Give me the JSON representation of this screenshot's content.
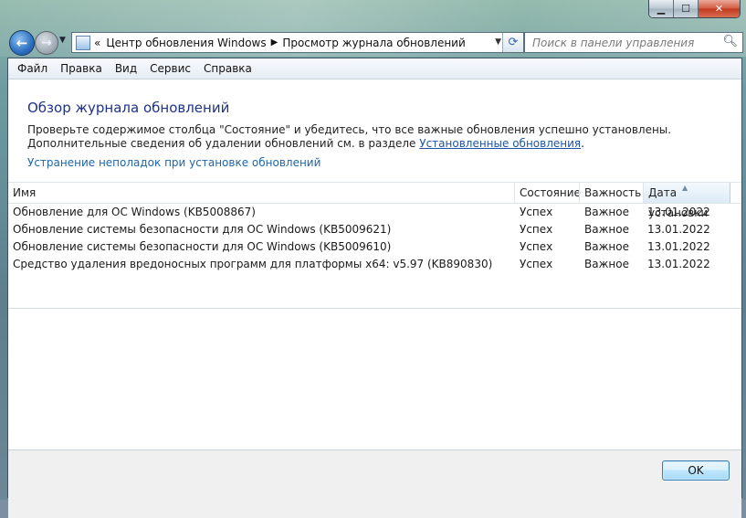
{
  "window": {
    "caption_buttons": {
      "minimize": "▁",
      "maximize": "☐",
      "close": "✕"
    }
  },
  "nav": {
    "back_icon": "arrow-left-icon",
    "forward_icon": "arrow-right-icon",
    "address": {
      "prefix": "«",
      "crumbs": [
        "Центр обновления Windows",
        "Просмотр журнала обновлений"
      ],
      "separator": "▶"
    },
    "search_placeholder": "Поиск в панели управления"
  },
  "menu": [
    "Файл",
    "Правка",
    "Вид",
    "Сервис",
    "Справка"
  ],
  "main": {
    "title": "Обзор журнала обновлений",
    "description_part1": "Проверьте содержимое столбца \"Состояние\" и убедитесь, что все важные обновления успешно установлены. Дополнительные сведения об удалении обновлений см. в разделе ",
    "description_link": "Установленные обновления",
    "description_end": ".",
    "troubleshoot_link": "Устранение неполадок при установке обновлений"
  },
  "table": {
    "columns": [
      "Имя",
      "Состояние",
      "Важность",
      "Дата установки"
    ],
    "sorted_column_index": 3,
    "rows": [
      [
        "Обновление для ОС Windows (KB5008867)",
        "Успех",
        "Важное",
        "13.01.2022"
      ],
      [
        "Обновление системы безопасности для ОС Windows (KB5009621)",
        "Успех",
        "Важное",
        "13.01.2022"
      ],
      [
        "Обновление системы безопасности для ОС Windows (KB5009610)",
        "Успех",
        "Важное",
        "13.01.2022"
      ],
      [
        "Средство удаления вредоносных программ для платформы x64: v5.97 (KB890830)",
        "Успех",
        "Важное",
        "13.01.2022"
      ]
    ]
  },
  "footer": {
    "ok_label": "OK"
  },
  "colors": {
    "title": "#1e3287",
    "link": "#1e66aa",
    "accent": "#3c7fb1"
  }
}
